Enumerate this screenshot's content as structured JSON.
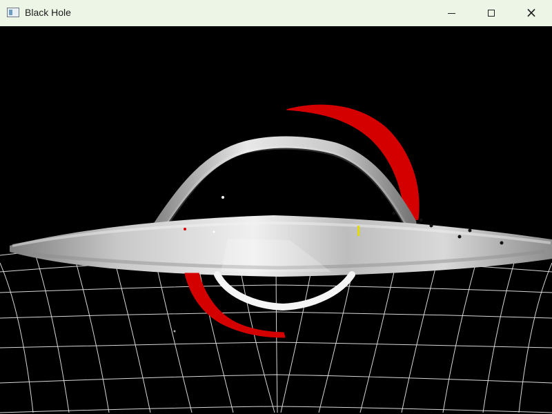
{
  "window": {
    "title": "Black Hole",
    "icon": "app-window-icon",
    "controls": {
      "minimize_icon": "minimize-icon",
      "maximize_icon": "maximize-icon",
      "close_icon": "close-icon"
    }
  },
  "scene": {
    "background_color": "#000000",
    "grid_color": "#ffffff",
    "disk_color": "#d8d8d8",
    "lensed_arc_color": "#d40000",
    "marker_color": "#e3dc00"
  }
}
